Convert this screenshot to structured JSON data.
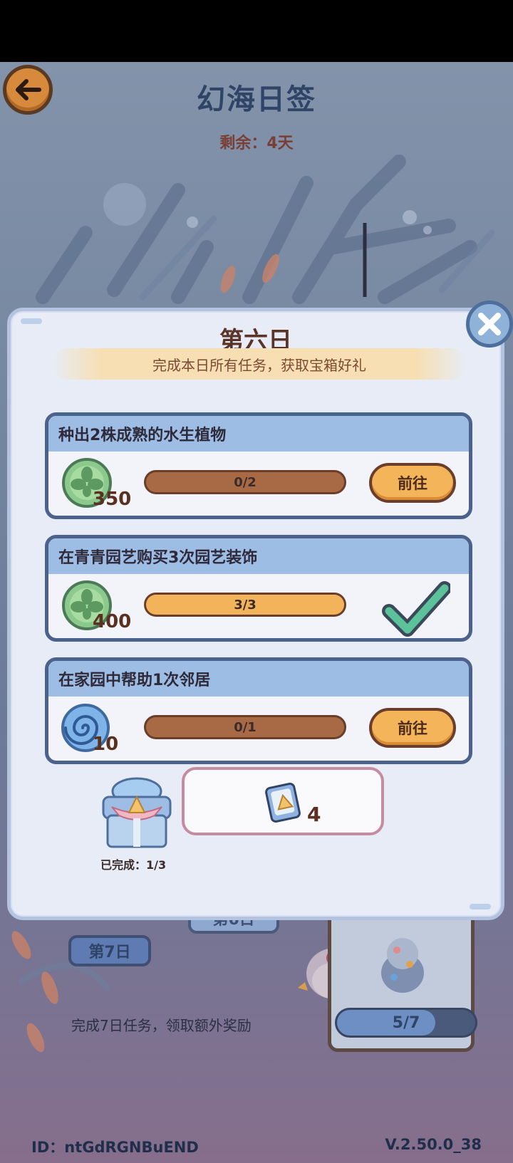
{
  "header": {
    "title": "幻海日签",
    "remaining": "剩余：4天"
  },
  "background": {
    "day7_label": "第7日",
    "day6_label": "第6日",
    "bonus_text": "完成7日任务，领取额外奖励",
    "bonus_progress_text": "5/7",
    "bonus_progress": 0.71
  },
  "modal": {
    "title": "第六日",
    "banner": "完成本日所有任务，获取宝箱好礼",
    "tasks": [
      {
        "title": "种出2株成熟的水生植物",
        "reward_icon": "clover-coin-icon",
        "reward_amount": "350",
        "progress_text": "0/2",
        "progress": 0,
        "action": "前往",
        "done": false
      },
      {
        "title": "在青青园艺购买3次园艺装饰",
        "reward_icon": "clover-coin-icon",
        "reward_amount": "400",
        "progress_text": "3/3",
        "progress": 1,
        "done": true
      },
      {
        "title": "在家园中帮助1次邻居",
        "reward_icon": "blue-swirl-icon",
        "reward_amount": "10",
        "progress_text": "0/1",
        "progress": 0,
        "action": "前往",
        "done": false
      }
    ],
    "chest": {
      "icon": "treasure-chest-icon",
      "completed": "已完成：1/3"
    },
    "reward": {
      "icon": "shell-scroll-icon",
      "count": "4"
    }
  },
  "footer": {
    "id": "ID：ntGdRGNBuEND",
    "version": "V.2.50.0_38"
  },
  "colors": {
    "task_border": "#4b628c",
    "task_header": "#9ebde5",
    "button_orange": "#f4b45a",
    "bar_brown": "#a86a45",
    "check_green": "#5cc29a"
  }
}
